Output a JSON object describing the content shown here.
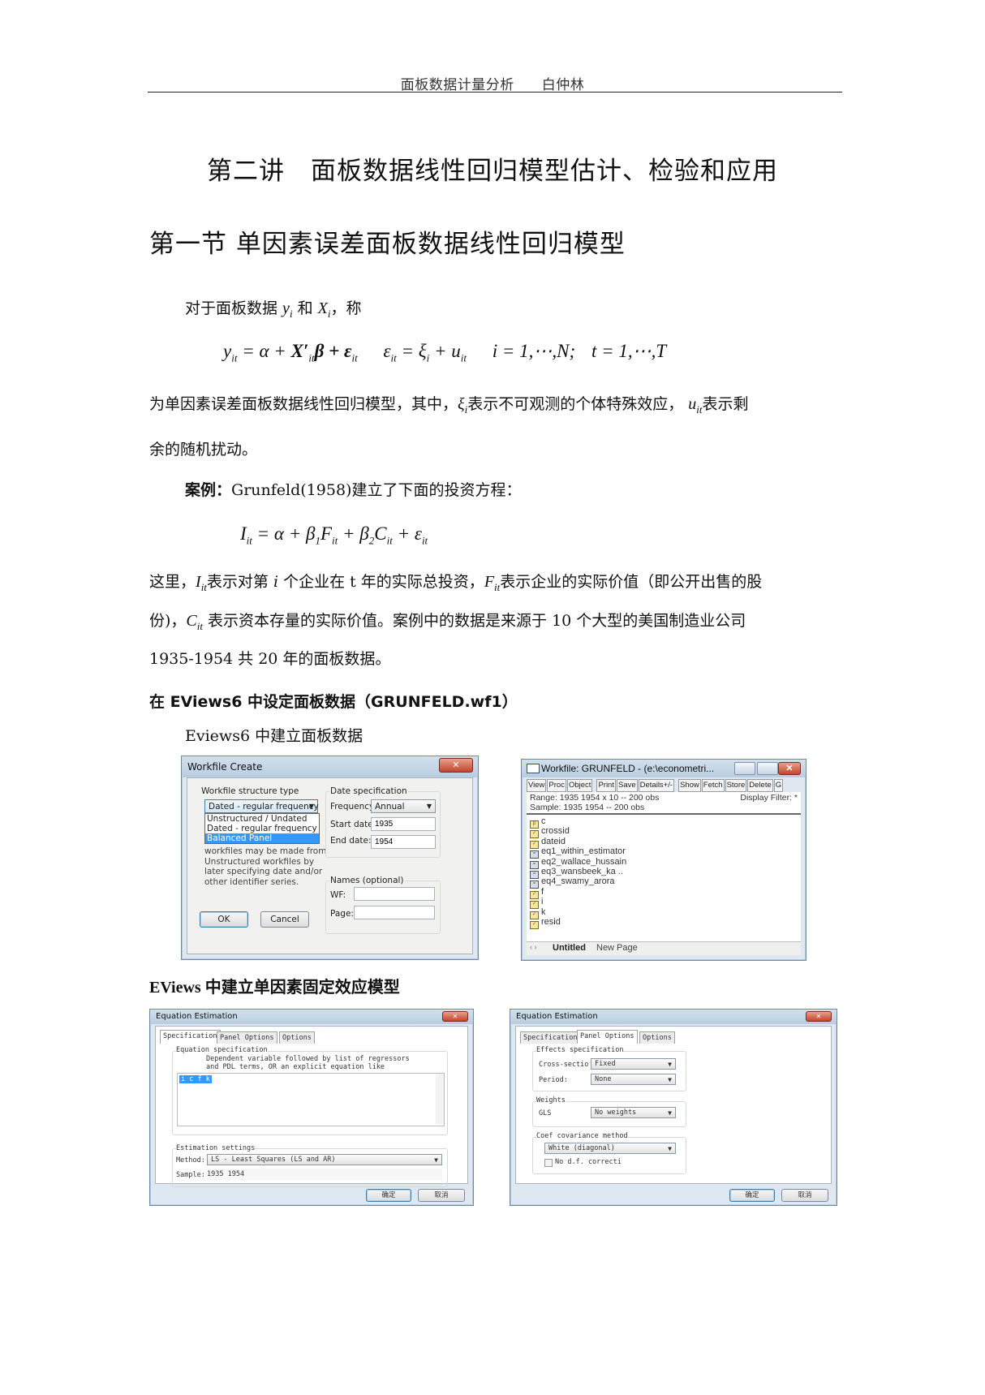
{
  "page_header": {
    "title": "面板数据计量分析",
    "author": "白仲林"
  },
  "lecture_title": "第二讲　面板数据线性回归模型估计、检验和应用",
  "section_title": "第一节 单因素误差面板数据线性回归模型",
  "intro": {
    "prefix": "对于面板数据 ",
    "y": "y",
    "y_sub": "i",
    "mid": " 和 ",
    "x": "X",
    "x_sub": "i",
    "suffix": "，称"
  },
  "model_equation": {
    "part1": "y",
    "part1_sub": "it",
    "part2": " = α + ",
    "part3": "X′",
    "part3_sub": "it",
    "part4": "β + ε",
    "part4_sub": "it",
    "part5": "ε",
    "part5_sub": "it",
    "part6": " = ξ",
    "part6_sub": "i",
    "part7": " + u",
    "part7_sub": "it",
    "part8": "i = 1,⋯,N;",
    "part9": "t = 1,⋯,T"
  },
  "para1": {
    "a": "为单因素误差面板数据线性回归模型，其中，",
    "xi": "ξ",
    "xi_sub": "i",
    "b": "表示不可观测的个体特殊效应，",
    "u": "u",
    "u_sub": "it",
    "c": "表示剩"
  },
  "para1_line2": "余的随机扰动。",
  "example": {
    "label": "案例：",
    "text": "Grunfeld(1958)建立了下面的投资方程："
  },
  "invest_equation": {
    "I": "I",
    "I_sub": "it",
    "a": " = α + β",
    "b1_sub": "1",
    "F": "F",
    "F_sub": "it",
    "b": " + β",
    "b2_sub": "2",
    "C": "C",
    "C_sub": "it",
    "c": " + ε",
    "e_sub": "it"
  },
  "para2": {
    "line1_a": "这里，",
    "I": "I",
    "I_sub": "it",
    "line1_b": "表示对第 ",
    "i": "i",
    "line1_c": " 个企业在 t 年的实际总投资，",
    "F": "F",
    "F_sub": "it",
    "line1_d": "表示企业的实际价值（即公开出售的股",
    "line2_a": "份)，",
    "C": "C",
    "C_sub": "it",
    "line2_b": " 表示资本存量的实际价值。案例中的数据是来源于  10  个大型的美国制造业公司",
    "line3": "1935-1954 共 20 年的面板数据。"
  },
  "subsection1": "在 EViews6 中设定面板数据（GRUNFELD.wf1）",
  "caption1": "Eviews6  中建立面板数据",
  "workfile_create": {
    "title": "Workfile Create",
    "close": "✕",
    "structure_label": "Workfile structure type",
    "structure_selected": "Dated - regular frequency",
    "structure_options": [
      "Unstructured / Undated",
      "Dated - regular frequency",
      "Balanced Panel"
    ],
    "highlighted_option": "Balanced Panel",
    "help_text": [
      "workfiles may be made from",
      "Unstructured workfiles by",
      "later specifying date and/or",
      "other identifier series."
    ],
    "date_spec_label": "Date specification",
    "frequency_label": "Frequency",
    "frequency_value": "Annual",
    "start_label": "Start date:",
    "start_value": "1935",
    "end_label": "End date:",
    "end_value": "1954",
    "names_label": "Names (optional)",
    "wf_label": "WF:",
    "page_label": "Page:",
    "ok": "OK",
    "cancel": "Cancel"
  },
  "workfile_window": {
    "title": "Workfile: GRUNFELD - (e:\\econometri...",
    "toolbar": [
      "View",
      "Proc",
      "Object",
      "Print",
      "Save",
      "Details+/-",
      "Show",
      "Fetch",
      "Store",
      "Delete",
      "G"
    ],
    "range": "Range:  1935 1954 x 10  --  200 obs",
    "display_filter": "Display Filter: *",
    "sample": "Sample: 1935 1954  --  200 obs",
    "objects": [
      {
        "name": "c",
        "type": "coef"
      },
      {
        "name": "crossid",
        "type": "series"
      },
      {
        "name": "dateid",
        "type": "series"
      },
      {
        "name": "eq1_within_estimator",
        "type": "equation"
      },
      {
        "name": "eq2_wallace_hussain",
        "type": "equation"
      },
      {
        "name": "eq3_wansbeek_ka ..",
        "type": "equation"
      },
      {
        "name": "eq4_swamy_arora",
        "type": "equation"
      },
      {
        "name": "f",
        "type": "series"
      },
      {
        "name": "i",
        "type": "series"
      },
      {
        "name": "k",
        "type": "series"
      },
      {
        "name": "resid",
        "type": "series"
      }
    ],
    "tabs": [
      "Untitled",
      "New Page"
    ],
    "nav": "‹ ›"
  },
  "subsection2": "EViews 中建立单因素固定效应模型",
  "eq_spec_dialog": {
    "title": "Equation Estimation",
    "tabs": [
      "Specification",
      "Panel Options",
      "Options"
    ],
    "active_tab": "Specification",
    "spec_group": "Equation specification",
    "spec_help": [
      "Dependent variable followed by list of regressors",
      "and PDL terms, OR an explicit equation like"
    ],
    "spec_value": "i c f k",
    "est_group": "Estimation settings",
    "method_label": "Method:",
    "method_value": "LS  -  Least Squares (LS and AR)",
    "sample_label": "Sample:",
    "sample_value": "1935 1954",
    "ok": "确定",
    "cancel": "取消"
  },
  "eq_panel_dialog": {
    "title": "Equation Estimation",
    "tabs": [
      "Specification",
      "Panel Options",
      "Options"
    ],
    "active_tab": "Panel Options",
    "effects_group": "Effects specification",
    "cross_label": "Cross-sectio",
    "cross_value": "Fixed",
    "period_label": "Period:",
    "period_value": "None",
    "weights_group": "Weights",
    "gls_label": "GLS",
    "gls_value": "No weights",
    "cov_group": "Coef covariance method",
    "cov_value": "White (diagonal)",
    "nodf_label": "No d.f. correcti",
    "nodf_checked": false,
    "ok": "确定",
    "cancel": "取消"
  }
}
